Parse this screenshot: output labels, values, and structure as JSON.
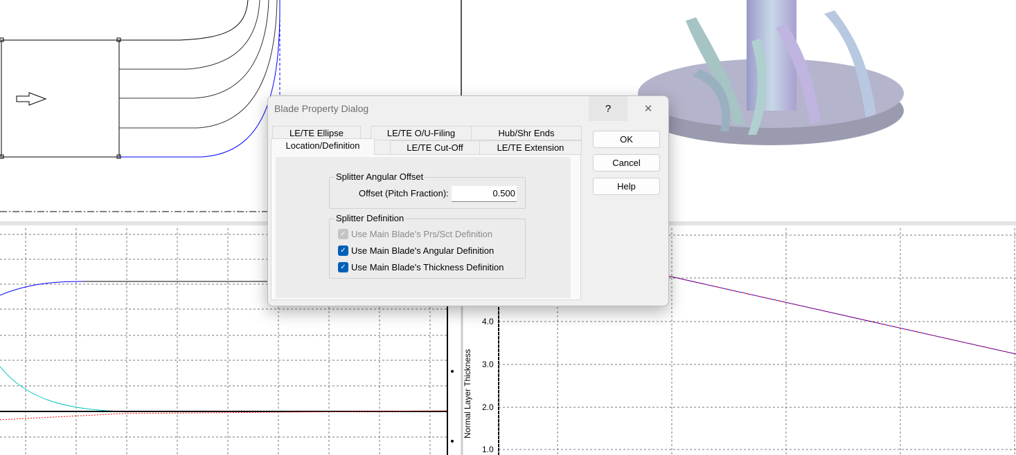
{
  "dialog": {
    "title": "Blade Property Dialog",
    "help_glyph": "?",
    "close_glyph": "✕",
    "tabs_row1": [
      "LE/TE Ellipse",
      "LE/TE O/U-Filing",
      "Hub/Shr Ends"
    ],
    "tabs_row2": [
      "Location/Definition",
      "LE/TE Cut-Off",
      "LE/TE Extension"
    ],
    "active_tab": "Location/Definition",
    "angular_offset": {
      "group_label": "Splitter Angular Offset",
      "field_label": "Offset (Pitch Fraction):",
      "value": "0.500"
    },
    "definition": {
      "group_label": "Splitter Definition",
      "checkboxes": [
        {
          "label": "Use Main Blade's Prs/Sct Definition",
          "checked": true,
          "disabled": true
        },
        {
          "label": "Use Main Blade's Angular Definition",
          "checked": true,
          "disabled": false
        },
        {
          "label": "Use Main Blade's Thickness Definition",
          "checked": true,
          "disabled": false
        }
      ]
    },
    "buttons": {
      "ok": "OK",
      "cancel": "Cancel",
      "help": "Help"
    }
  },
  "thickness_plot": {
    "ylabel": "Normal Layer Thickness",
    "yticks": [
      "4.0",
      "3.0",
      "2.0",
      "1.0"
    ]
  },
  "colors": {
    "accent": "#005fb8",
    "curve_blue": "#0000ff",
    "curve_red": "#ff0000",
    "curve_cyan": "#00c0c0"
  }
}
